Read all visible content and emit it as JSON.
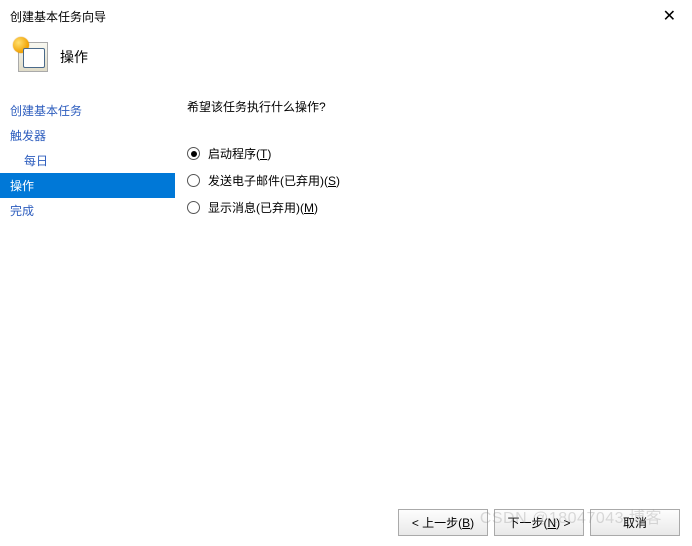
{
  "window": {
    "title": "创建基本任务向导",
    "close_symbol": "✕"
  },
  "header": {
    "title": "操作"
  },
  "sidebar": {
    "items": [
      {
        "label": "创建基本任务",
        "indent": false,
        "selected": false
      },
      {
        "label": "触发器",
        "indent": false,
        "selected": false
      },
      {
        "label": "每日",
        "indent": true,
        "selected": false
      },
      {
        "label": "操作",
        "indent": false,
        "selected": true
      },
      {
        "label": "完成",
        "indent": false,
        "selected": false
      }
    ]
  },
  "content": {
    "question": "希望该任务执行什么操作?",
    "options": [
      {
        "label_pre": "启动程序(",
        "hotkey": "T",
        "label_post": ")",
        "checked": true
      },
      {
        "label_pre": "发送电子邮件(已弃用)(",
        "hotkey": "S",
        "label_post": ")",
        "checked": false
      },
      {
        "label_pre": "显示消息(已弃用)(",
        "hotkey": "M",
        "label_post": ")",
        "checked": false
      }
    ]
  },
  "footer": {
    "back_pre": "< 上一步(",
    "back_hotkey": "B",
    "back_post": ")",
    "next_pre": "下一步(",
    "next_hotkey": "N",
    "next_post": ") >",
    "cancel": "取消"
  },
  "watermark": "CSDN @18047043 博客"
}
